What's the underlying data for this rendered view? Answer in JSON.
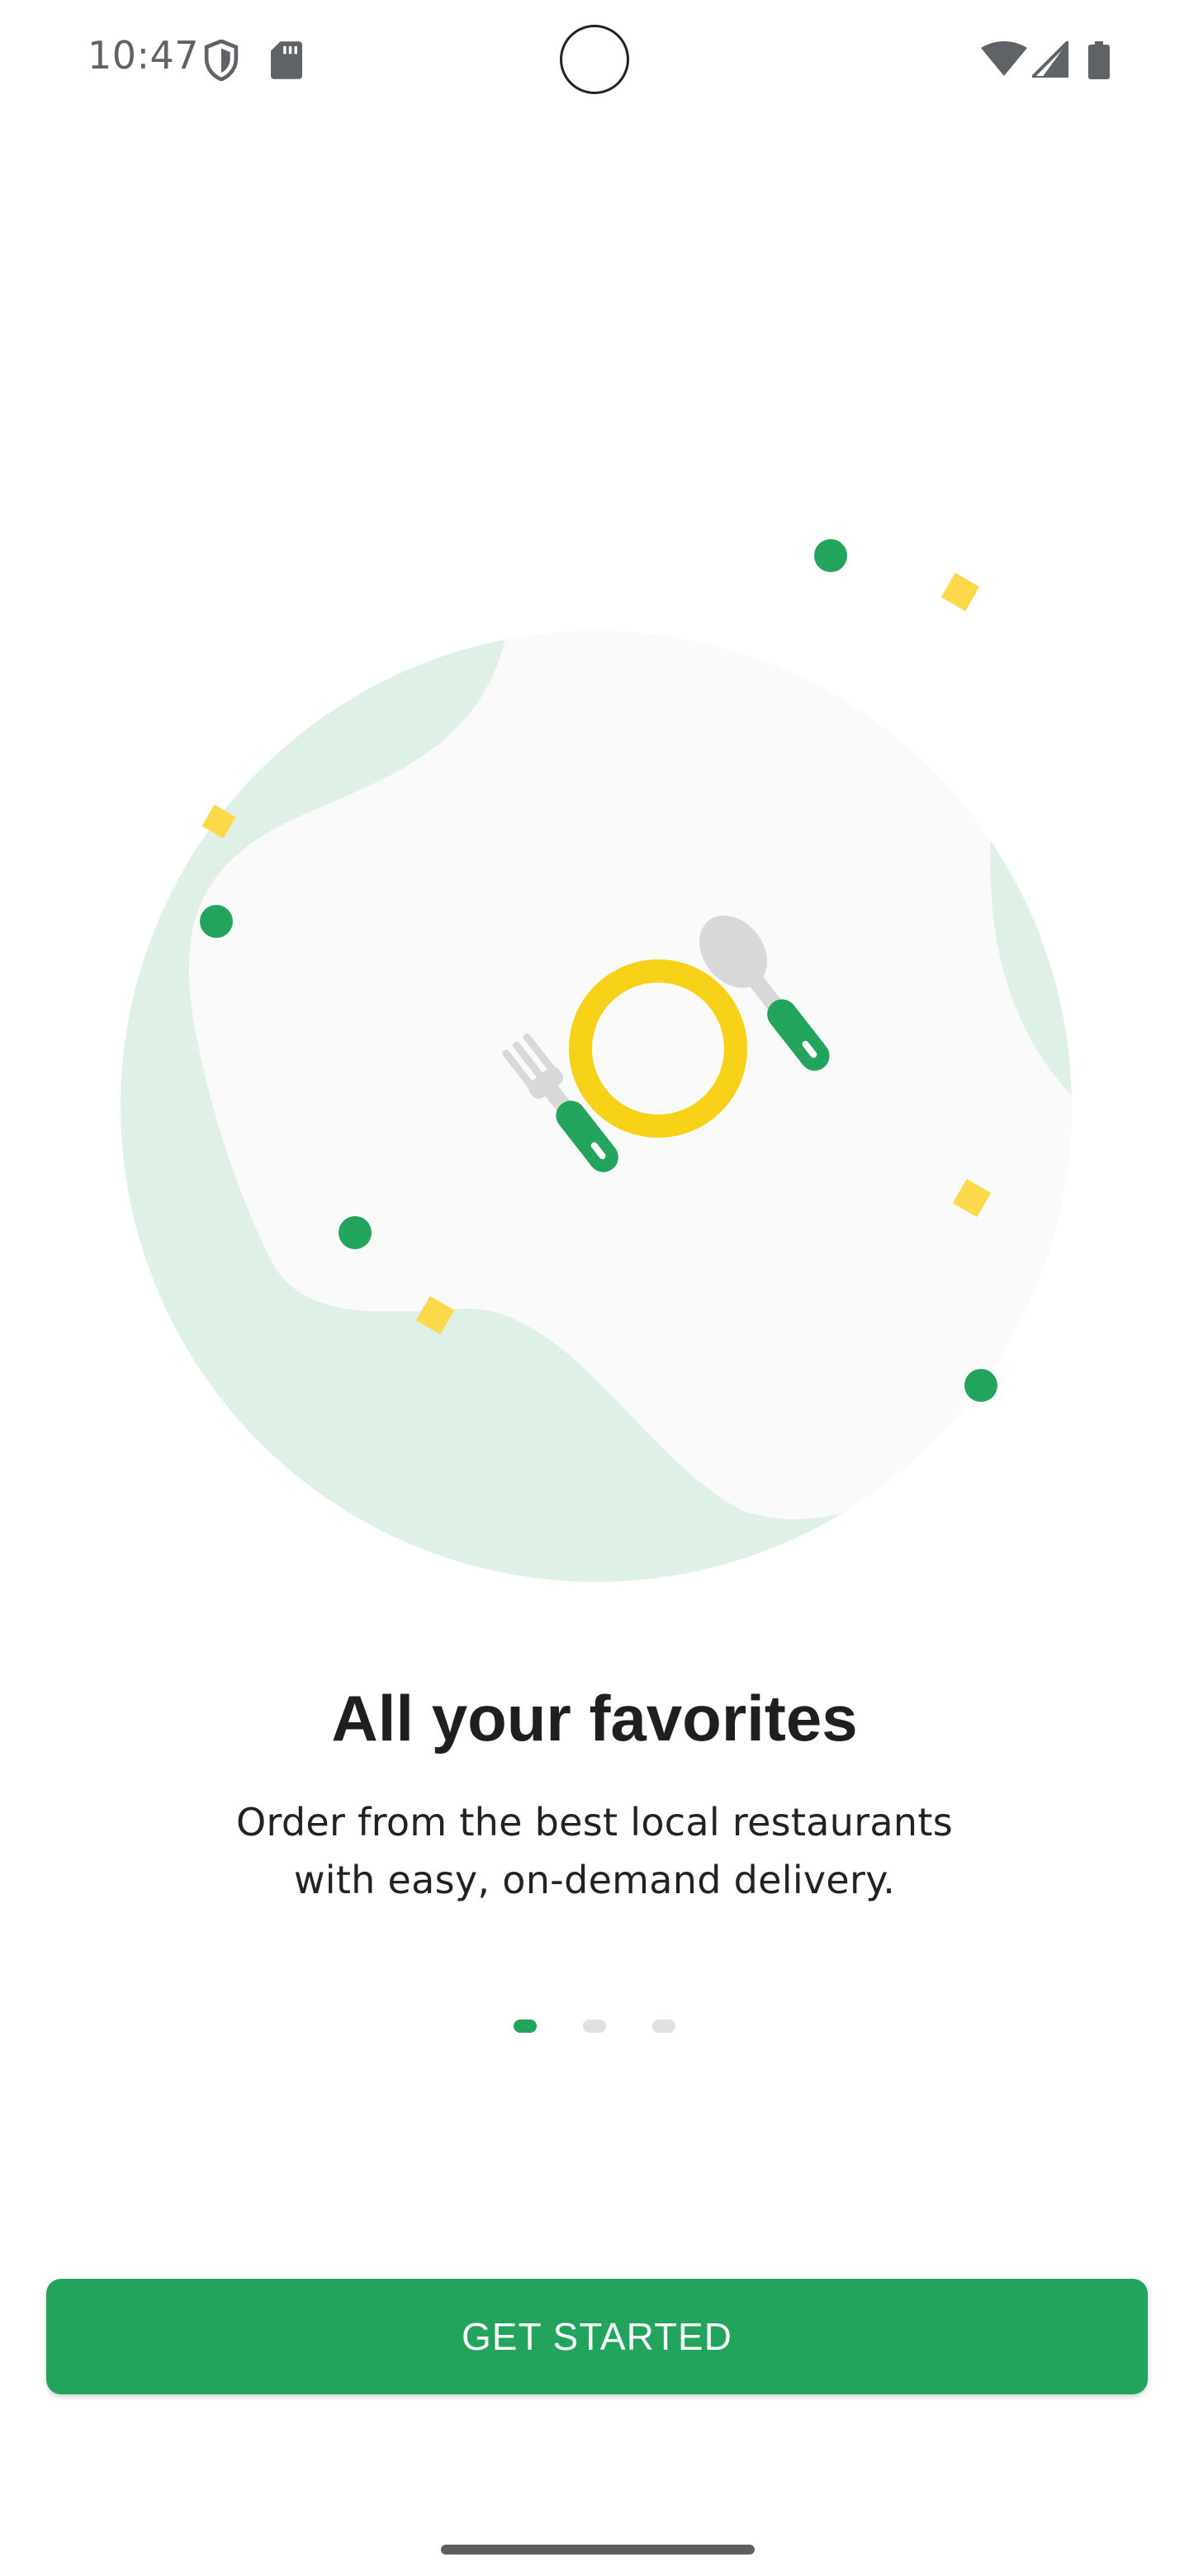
{
  "status_bar": {
    "time": "10:47",
    "icons": [
      "shield-icon",
      "sd-card-icon",
      "wifi-icon",
      "signal-icon",
      "battery-icon"
    ]
  },
  "onboarding": {
    "illustration": {
      "icons": [
        "plate-icon",
        "fork-icon",
        "spoon-icon"
      ],
      "colors": {
        "blob": "#dff1e7",
        "plate": "#f7d117",
        "accent_green": "#22a45d",
        "accent_yellow": "#fbd94a",
        "utensil_grey": "#dcdcdc"
      }
    },
    "title": "All your favorites",
    "subtitle_line1": "Order from the best local restaurants",
    "subtitle_line2": "with easy, on-demand delivery.",
    "page_indicator": {
      "active_index": 0,
      "count": 3,
      "active_color": "#22a45d",
      "inactive_color": "#e0e0e0"
    },
    "cta_label": "GET STARTED"
  },
  "theme": {
    "primary": "#22a45d",
    "background": "#ffffff"
  }
}
